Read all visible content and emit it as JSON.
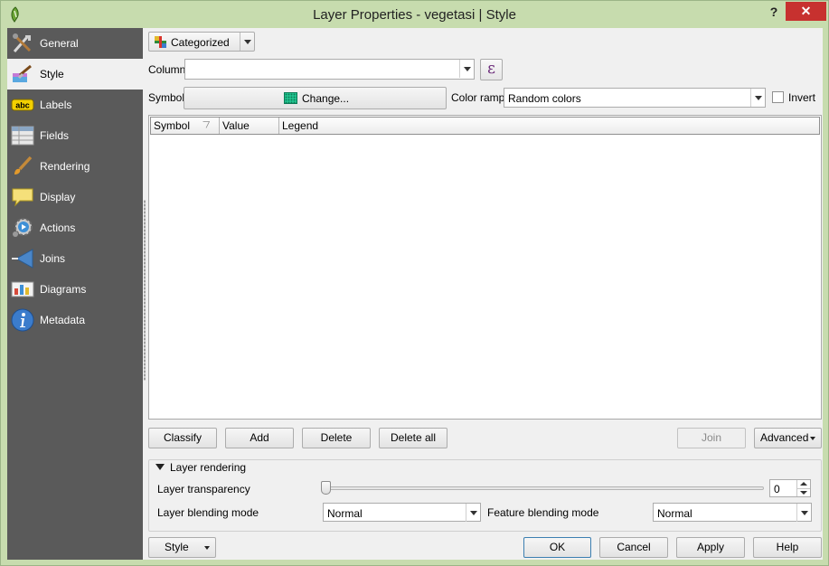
{
  "window": {
    "title": "Layer Properties - vegetasi | Style",
    "help_label": "?",
    "close_label": "✕"
  },
  "sidebar": {
    "items": [
      {
        "label": "General",
        "icon": "tools-icon"
      },
      {
        "label": "Style",
        "icon": "paintbrush-icon"
      },
      {
        "label": "Labels",
        "icon": "abc-label-icon"
      },
      {
        "label": "Fields",
        "icon": "table-icon"
      },
      {
        "label": "Rendering",
        "icon": "brush-icon"
      },
      {
        "label": "Display",
        "icon": "speech-bubble-icon"
      },
      {
        "label": "Actions",
        "icon": "gear-play-icon"
      },
      {
        "label": "Joins",
        "icon": "join-arrow-icon"
      },
      {
        "label": "Diagrams",
        "icon": "chart-icon"
      },
      {
        "label": "Metadata",
        "icon": "info-icon"
      }
    ],
    "active": "Style"
  },
  "style": {
    "renderer": "Categorized",
    "column_label": "Column",
    "column_value": "",
    "expression_label": "ε",
    "symbol_label": "Symbol",
    "symbol_button_label": "Change...",
    "color_ramp_label": "Color ramp",
    "color_ramp_value": "Random colors",
    "invert_label": "Invert",
    "invert_checked": false,
    "table_headers": [
      "Symbol",
      "Value",
      "Legend"
    ],
    "rows": [],
    "buttons": {
      "classify": "Classify",
      "add": "Add",
      "delete": "Delete",
      "delete_all": "Delete all",
      "join": "Join",
      "advanced": "Advanced"
    }
  },
  "layer_rendering": {
    "title": "Layer rendering",
    "transparency_label": "Layer transparency",
    "transparency_value": "0",
    "layer_blending_label": "Layer blending mode",
    "layer_blending_value": "Normal",
    "feature_blending_label": "Feature blending mode",
    "feature_blending_value": "Normal"
  },
  "footer": {
    "style_menu": "Style",
    "ok": "OK",
    "cancel": "Cancel",
    "apply": "Apply",
    "help": "Help"
  },
  "colors": {
    "titlebar": "#c7dcae",
    "sidebar": "#5a5a5a",
    "close_button": "#c7312f",
    "symbol_swatch": "#21c28e"
  }
}
